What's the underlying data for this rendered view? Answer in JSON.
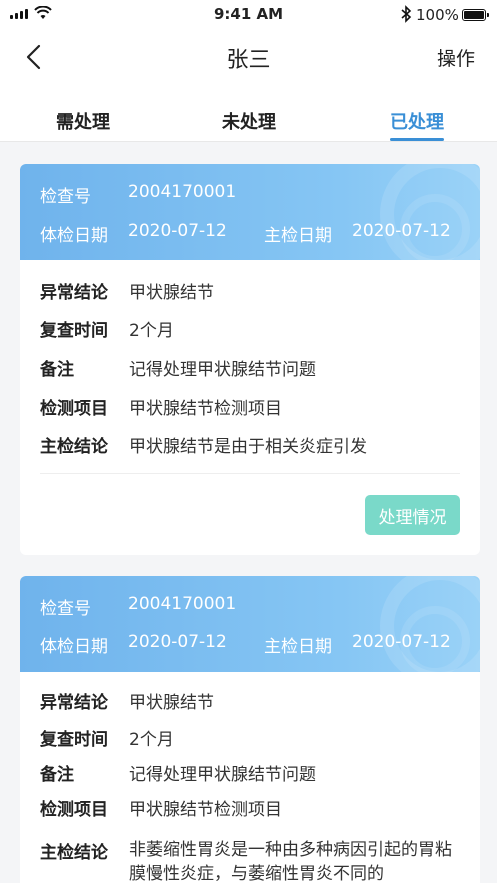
{
  "status_bar": {
    "time": "9:41 AM",
    "battery": "100%"
  },
  "nav": {
    "title": "张三",
    "action": "操作"
  },
  "tabs": [
    {
      "label": "需处理",
      "active": false
    },
    {
      "label": "未处理",
      "active": false
    },
    {
      "label": "已处理",
      "active": true
    }
  ],
  "colors": {
    "accent": "#3a8fd6",
    "header_gradient_start": "#6fb3ec",
    "button": "#7ad9c9"
  },
  "labels": {
    "exam_no": "检查号",
    "exam_date": "体检日期",
    "chief_date": "主检日期",
    "abnormal": "异常结论",
    "recheck": "复查时间",
    "remark": "备注",
    "items": "检测项目",
    "chief_conclusion": "主检结论",
    "status_button": "处理情况"
  },
  "records": [
    {
      "exam_no": "2004170001",
      "exam_date": "2020-07-12",
      "chief_date": "2020-07-12",
      "abnormal": "甲状腺结节",
      "recheck": "2个月",
      "remark": "记得处理甲状腺结节问题",
      "items": "甲状腺结节检测项目",
      "chief_conclusion": "甲状腺结节是由于相关炎症引发"
    },
    {
      "exam_no": "2004170001",
      "exam_date": "2020-07-12",
      "chief_date": "2020-07-12",
      "abnormal": "甲状腺结节",
      "recheck": "2个月",
      "remark": "记得处理甲状腺结节问题",
      "items": "甲状腺结节检测项目",
      "chief_conclusion": "非萎缩性胃炎是一种由多种病因引起的胃粘膜慢性炎症，与萎缩性胃炎不同的"
    }
  ]
}
